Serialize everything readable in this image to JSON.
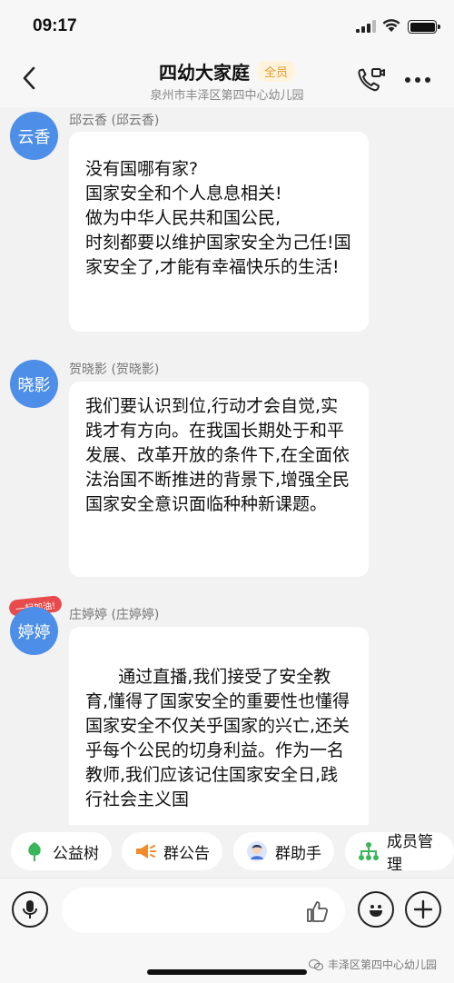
{
  "status": {
    "time": "09:17"
  },
  "header": {
    "title": "四幼大家庭",
    "badge": "全员",
    "subtitle": "泉州市丰泽区第四中心幼儿园"
  },
  "messages": [
    {
      "avatar_text": "云香",
      "sender": "邱云香 (邱云香)",
      "text": "没有国哪有家?\n国家安全和个人息息相关!\n做为中华人民共和国公民,\n时刻都要以维护国家安全为己任!国家安全了,才能有幸福快乐的生活!"
    },
    {
      "avatar_text": "晓影",
      "sender": "贺晓影 (贺晓影)",
      "text": "我们要认识到位,行动才会自觉,实践才有方向。在我国长期处于和平发展、改革开放的条件下,在全面依法治国不断推进的背景下,增强全民国家安全意识面临种种新课题。"
    },
    {
      "avatar_text": "婷婷",
      "avatar_tag": "一起加油!",
      "sender": "庄婷婷 (庄婷婷)",
      "text": "      通过直播,我们接受了安全教育,懂得了国家安全的重要性也懂得国家安全不仅关乎国家的兴亡,还关乎每个公民的切身利益。作为一名教师,我们应该记住国家安全日,践行社会主义国"
    }
  ],
  "actions": [
    {
      "label": "公益树",
      "icon": "tree-icon",
      "color": "#3bb55a"
    },
    {
      "label": "群公告",
      "icon": "megaphone-icon",
      "color": "#f28a2e"
    },
    {
      "label": "群助手",
      "icon": "assistant-avatar-icon",
      "color": "#4a74d9"
    },
    {
      "label": "成员管理",
      "icon": "members-icon",
      "color": "#3bb55a"
    }
  ],
  "input": {
    "placeholder": ""
  },
  "watermark": "丰泽区第四中心幼儿园",
  "colors": {
    "avatar": "#4c8ee8",
    "badge_text": "#e39b2d",
    "badge_bg": "#fff3dc"
  }
}
